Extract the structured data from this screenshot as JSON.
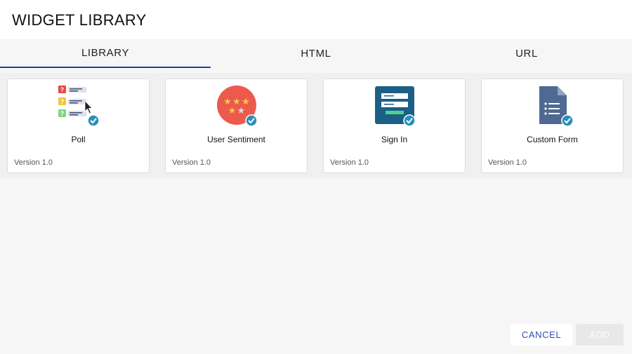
{
  "dialog": {
    "title": "WIDGET LIBRARY"
  },
  "tabs": [
    {
      "label": "LIBRARY",
      "active": true
    },
    {
      "label": "HTML",
      "active": false
    },
    {
      "label": "URL",
      "active": false
    }
  ],
  "widgets": [
    {
      "name": "Poll",
      "version": "Version 1.0",
      "icon": "poll-icon"
    },
    {
      "name": "User Sentiment",
      "version": "Version 1.0",
      "icon": "star-rating-icon"
    },
    {
      "name": "Sign In",
      "version": "Version 1.0",
      "icon": "sign-in-form-icon"
    },
    {
      "name": "Custom Form",
      "version": "Version 1.0",
      "icon": "document-form-icon"
    }
  ],
  "footer": {
    "cancel_label": "CANCEL",
    "add_label": "ADD",
    "add_enabled": false
  },
  "colors": {
    "accent": "#1f3fa8",
    "check_badge": "#2a8fb8",
    "sentiment_circle": "#ec5a4e",
    "sign_in_tile": "#1b5f86",
    "custom_form_doc": "#4f6a92"
  }
}
